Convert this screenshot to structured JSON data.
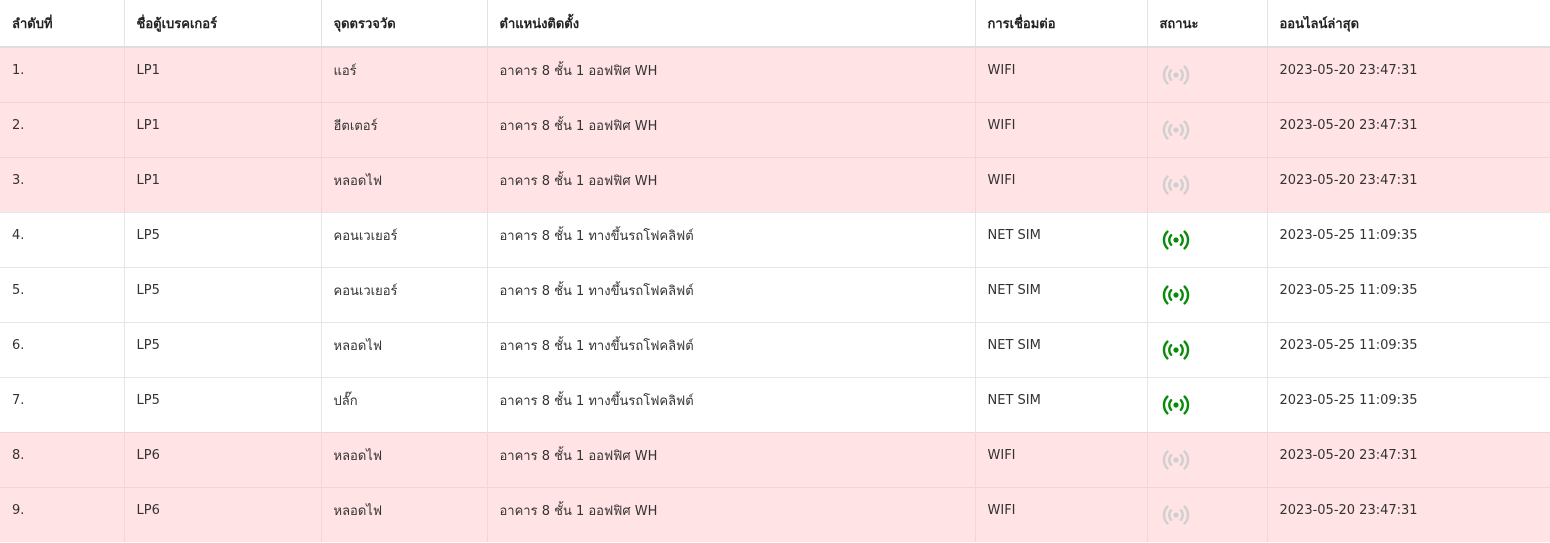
{
  "table": {
    "headers": {
      "index": "ลำดับที่",
      "breaker_name": "ชื่อตู้เบรคเกอร์",
      "checkpoint": "จุดตรวจวัด",
      "location": "ตำแหน่งติดตั้ง",
      "connection": "การเชื่อมต่อ",
      "status": "สถานะ",
      "last_online": "ออนไลน์ล่าสุด"
    },
    "rows": [
      {
        "index": "1.",
        "breaker_name": "LP1",
        "checkpoint": "แอร์",
        "location": "อาคาร 8 ชั้น 1 ออฟฟิศ WH",
        "connection": "WIFI",
        "status": "offline",
        "status_icon": "wireless-signal-icon",
        "last_online": "2023-05-20 23:47:31"
      },
      {
        "index": "2.",
        "breaker_name": "LP1",
        "checkpoint": "ฮีตเตอร์",
        "location": "อาคาร 8 ชั้น 1 ออฟฟิศ WH",
        "connection": "WIFI",
        "status": "offline",
        "status_icon": "wireless-signal-icon",
        "last_online": "2023-05-20 23:47:31"
      },
      {
        "index": "3.",
        "breaker_name": "LP1",
        "checkpoint": "หลอดไฟ",
        "location": "อาคาร 8 ชั้น 1 ออฟฟิศ WH",
        "connection": "WIFI",
        "status": "offline",
        "status_icon": "wireless-signal-icon",
        "last_online": "2023-05-20 23:47:31"
      },
      {
        "index": "4.",
        "breaker_name": "LP5",
        "checkpoint": "คอนเวเยอร์",
        "location": "อาคาร 8 ชั้น 1 ทางขึ้นรถโฟคลิฟต์",
        "connection": "NET SIM",
        "status": "online",
        "status_icon": "wireless-signal-icon",
        "last_online": "2023-05-25 11:09:35"
      },
      {
        "index": "5.",
        "breaker_name": "LP5",
        "checkpoint": "คอนเวเยอร์",
        "location": "อาคาร 8 ชั้น 1 ทางขึ้นรถโฟคลิฟต์",
        "connection": "NET SIM",
        "status": "online",
        "status_icon": "wireless-signal-icon",
        "last_online": "2023-05-25 11:09:35"
      },
      {
        "index": "6.",
        "breaker_name": "LP5",
        "checkpoint": "หลอดไฟ",
        "location": "อาคาร 8 ชั้น 1 ทางขึ้นรถโฟคลิฟต์",
        "connection": "NET SIM",
        "status": "online",
        "status_icon": "wireless-signal-icon",
        "last_online": "2023-05-25 11:09:35"
      },
      {
        "index": "7.",
        "breaker_name": "LP5",
        "checkpoint": "ปลั๊ก",
        "location": "อาคาร 8 ชั้น 1 ทางขึ้นรถโฟคลิฟต์",
        "connection": "NET SIM",
        "status": "online",
        "status_icon": "wireless-signal-icon",
        "last_online": "2023-05-25 11:09:35"
      },
      {
        "index": "8.",
        "breaker_name": "LP6",
        "checkpoint": "หลอดไฟ",
        "location": "อาคาร 8 ชั้น 1 ออฟฟิศ WH",
        "connection": "WIFI",
        "status": "offline",
        "status_icon": "wireless-signal-icon",
        "last_online": "2023-05-20 23:47:31"
      },
      {
        "index": "9.",
        "breaker_name": "LP6",
        "checkpoint": "หลอดไฟ",
        "location": "อาคาร 8 ชั้น 1 ออฟฟิศ WH",
        "connection": "WIFI",
        "status": "offline",
        "status_icon": "wireless-signal-icon",
        "last_online": "2023-05-20 23:47:31"
      }
    ]
  },
  "colors": {
    "offline_row_bg": "#ffe3e5",
    "online_row_bg": "#ffffff",
    "online_icon": "#0a8a0a",
    "offline_icon": "#cfcfcf"
  }
}
